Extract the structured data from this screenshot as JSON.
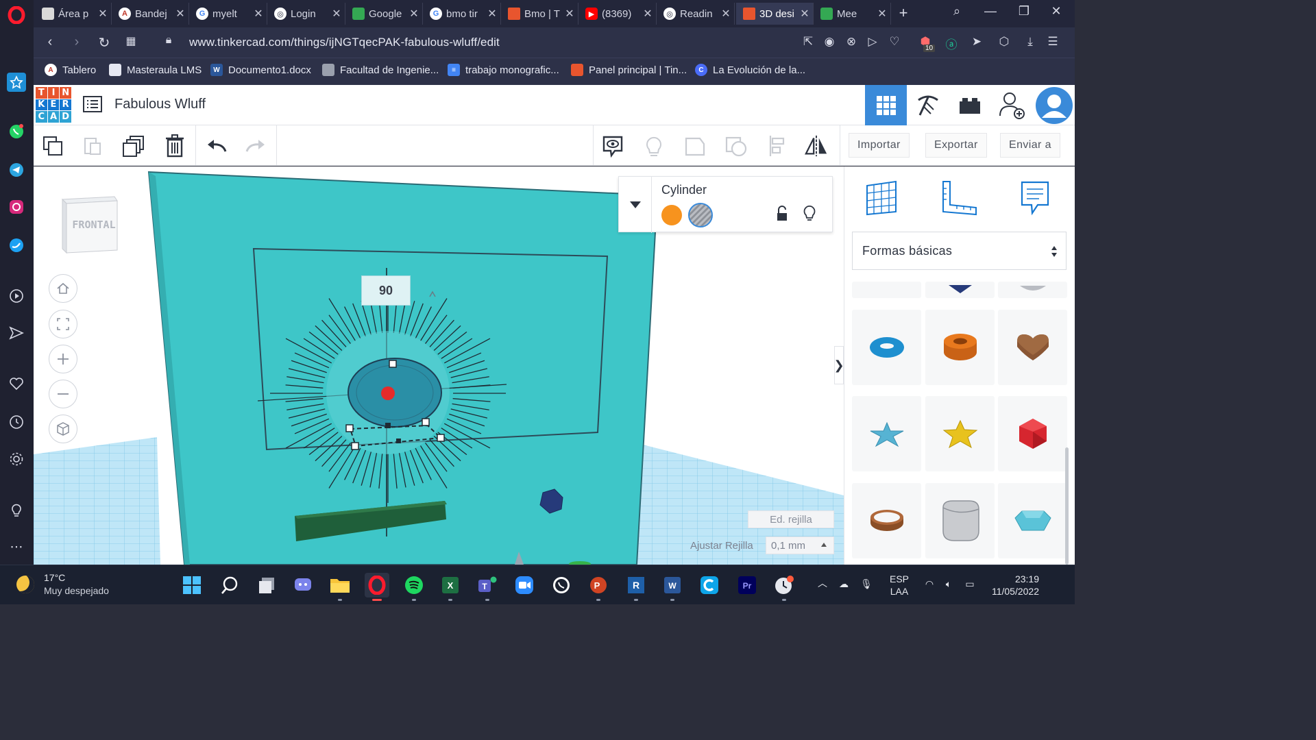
{
  "browser": {
    "tabs": [
      {
        "label": "Área p",
        "favicon": "doc-icon",
        "color": "#d9d9d9"
      },
      {
        "label": "Bandej",
        "favicon": "a-icon",
        "color": "#ffffff"
      },
      {
        "label": "myelt",
        "favicon": "google-icon",
        "color": "#ffffff"
      },
      {
        "label": "Login",
        "favicon": "globe-icon",
        "color": "#ffffff"
      },
      {
        "label": "Google",
        "favicon": "meet-icon",
        "color": "#34a853"
      },
      {
        "label": "bmo tir",
        "favicon": "google-icon",
        "color": "#ffffff"
      },
      {
        "label": "Bmo | T",
        "favicon": "tinkercad-icon",
        "color": "#e8552e"
      },
      {
        "label": "(8369)",
        "favicon": "youtube-icon",
        "color": "#ff0000"
      },
      {
        "label": "Readin",
        "favicon": "globe-icon",
        "color": "#ffffff"
      },
      {
        "label": "3D desi",
        "favicon": "tinkercad-icon",
        "color": "#e8552e"
      },
      {
        "label": "Mee",
        "favicon": "meet-icon",
        "color": "#34a853"
      }
    ],
    "active_tab_index": 9,
    "url": "www.tinkercad.com/things/ijNGTqecPAK-fabulous-wluff/edit",
    "bookmarks": [
      {
        "label": "Tablero",
        "favicon": "a-icon",
        "color": "#ffffff"
      },
      {
        "label": "Masteraula LMS",
        "favicon": "doc-icon",
        "color": "#e6e8f2"
      },
      {
        "label": "Documento1.docx",
        "favicon": "word-icon",
        "color": "#2b579a"
      },
      {
        "label": "Facultad de Ingenie...",
        "favicon": "building-icon",
        "color": "#9aa0ad"
      },
      {
        "label": "trabajo monografic...",
        "favicon": "docs-icon",
        "color": "#4285f4"
      },
      {
        "label": "Panel principal | Tin...",
        "favicon": "tinkercad-icon",
        "color": "#e8552e"
      },
      {
        "label": "La Evolución de la...",
        "favicon": "c-icon",
        "color": "#4a6cf7"
      }
    ],
    "notification_badge": "10"
  },
  "tinkercad": {
    "logo_letters": [
      "T",
      "I",
      "N",
      "K",
      "E",
      "R",
      "C",
      "A",
      "D"
    ],
    "logo_colors": [
      "#e8552e",
      "#e8552e",
      "#e8552e",
      "#1477d1",
      "#1477d1",
      "#1477d1",
      "#2ea3d4",
      "#2ea3d4",
      "#2ea3d4"
    ],
    "design_title": "Fabulous Wluff",
    "toolbar": {
      "import_label": "Importar",
      "export_label": "Exportar",
      "send_label": "Enviar a"
    },
    "viewcube_label": "FRONTAL",
    "inspector": {
      "shape_name": "Cylinder",
      "solid_color": "#f7931e"
    },
    "rotation_value": "90",
    "edit_grid_label": "Ed. rejilla",
    "snap_grid_label": "Ajustar Rejilla",
    "snap_grid_value": "0,1 mm",
    "shapes_library": "Formas básicas",
    "shapes": [
      {
        "name": "torus",
        "color": "#1e8fcf"
      },
      {
        "name": "tube",
        "color": "#e8791e"
      },
      {
        "name": "heart",
        "color": "#a06a42"
      },
      {
        "name": "star-flat",
        "color": "#56b3d3"
      },
      {
        "name": "star",
        "color": "#e8c21e"
      },
      {
        "name": "icosahedron",
        "color": "#d6262f"
      },
      {
        "name": "ring",
        "color": "#b0683a"
      },
      {
        "name": "round-roof",
        "color": "#c9cbcf"
      },
      {
        "name": "gem",
        "color": "#5ac3d8"
      }
    ],
    "accent": "#1477d1",
    "workplane_color": "#3ec6c8"
  },
  "taskbar": {
    "weather_temp": "17°C",
    "weather_desc": "Muy despejado",
    "language_top": "ESP",
    "language_bottom": "LAA",
    "time": "23:19",
    "date": "11/05/2022"
  }
}
